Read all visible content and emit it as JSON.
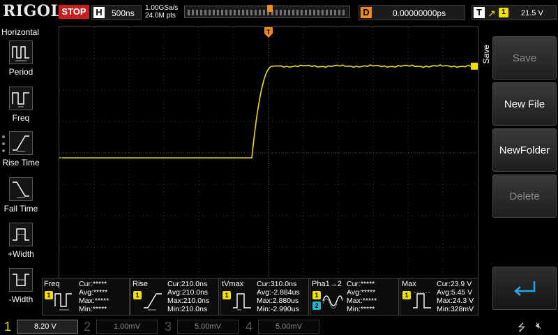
{
  "brand": {
    "logo": "RIGOL"
  },
  "topbar": {
    "run_state": "STOP",
    "timebase": {
      "tag": "H",
      "value": "500ns"
    },
    "sample_rate": "1.00GSa/s",
    "points": "24.0M pts",
    "delay": {
      "tag": "D",
      "value": "0.00000000ps"
    },
    "trigger": {
      "tag": "T",
      "source": "1",
      "level": "21.5 V"
    }
  },
  "left_menu": {
    "title": "Horizontal",
    "items": [
      {
        "label": "Period",
        "icon": "period-icon"
      },
      {
        "label": "Freq",
        "icon": "freq-icon"
      },
      {
        "label": "Rise Time",
        "icon": "rise-time-icon"
      },
      {
        "label": "Fall Time",
        "icon": "fall-time-icon"
      },
      {
        "label": "+Width",
        "icon": "pos-width-icon"
      },
      {
        "label": "-Width",
        "icon": "neg-width-icon"
      }
    ]
  },
  "right_menu": {
    "title": "Save",
    "buttons": [
      {
        "label": "Save",
        "enabled": false
      },
      {
        "label": "New File",
        "enabled": true
      },
      {
        "label": "NewFolder",
        "enabled": true
      },
      {
        "label": "Delete",
        "enabled": false
      },
      {
        "label": "",
        "icon": "return-icon",
        "enabled": true
      }
    ]
  },
  "waveform": {
    "channel": "1",
    "color": "#f0e000",
    "low_level_fraction": 0.52,
    "high_level_fraction": 0.155,
    "edge_start_fraction": 0.46,
    "edge_end_fraction": 0.51
  },
  "measurements": [
    {
      "name": "Freq",
      "channels": [
        "1"
      ],
      "icon": "freq-meas-icon",
      "lines": [
        "Cur:*****",
        "Avg:*****",
        "Max:*****",
        "Min:*****"
      ]
    },
    {
      "name": "Rise",
      "channels": [
        "1"
      ],
      "icon": "rise-meas-icon",
      "lines": [
        "Cur:210.0ns",
        "Avg:210.0ns",
        "Max:210.0ns",
        "Min:210.0ns"
      ]
    },
    {
      "name": "tVmax",
      "channels": [
        "1"
      ],
      "icon": "tvmax-meas-icon",
      "lines": [
        "Cur:310.0ns",
        "Avg:-2.884us",
        "Max:2.880us",
        "Min:-2.990us"
      ]
    },
    {
      "name": "Pha1→2",
      "channels": [
        "1",
        "2"
      ],
      "icon": "phase-meas-icon",
      "lines": [
        "Cur:*****",
        "Avg:*****",
        "Max:*****",
        "Min:*****"
      ]
    },
    {
      "name": "Max",
      "channels": [
        "1"
      ],
      "icon": "max-meas-icon",
      "lines": [
        "Cur:23.9 V",
        "Avg:5.45 V",
        "Max:24.3 V",
        "Min:328mV"
      ]
    }
  ],
  "channels": [
    {
      "num": "1",
      "scale": "8.20 V",
      "active": true
    },
    {
      "num": "2",
      "scale": "1.00mV",
      "active": false
    },
    {
      "num": "3",
      "scale": "5.00mV",
      "active": false
    },
    {
      "num": "4",
      "scale": "5.00mV",
      "active": false
    }
  ],
  "colors": {
    "ch1": "#f0e000",
    "ch2": "#22b8cc",
    "stop": "#c81e1e",
    "trigger_marker": "#f08a1a"
  }
}
